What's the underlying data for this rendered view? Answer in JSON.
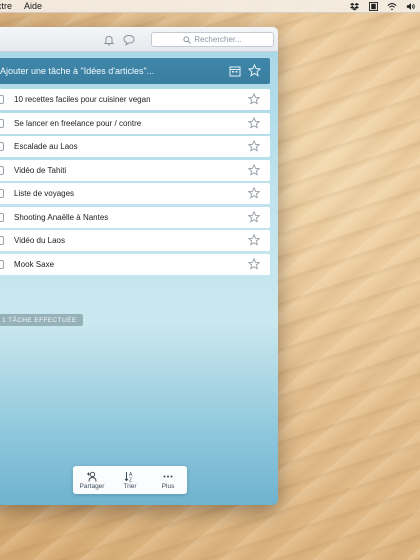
{
  "menubar": {
    "items": [
      "ctre",
      "Aide"
    ]
  },
  "window": {
    "search": {
      "placeholder": "Rechercher..."
    },
    "add_task": {
      "placeholder": "Ajouter une tâche à \"Idées d'articles\"..."
    },
    "tasks": [
      {
        "label": "10 recettes faciles pour cuisiner vegan",
        "checked": false,
        "starred": false
      },
      {
        "label": "Se lancer en freelance pour / contre",
        "checked": false,
        "starred": false
      },
      {
        "label": "Escalade au Laos",
        "checked": false,
        "starred": false
      },
      {
        "label": "Vidéo de Tahiti",
        "checked": false,
        "starred": false
      },
      {
        "label": "Liste de voyages",
        "checked": false,
        "starred": false
      },
      {
        "label": "Shooting Anaëlle à Nantes",
        "checked": false,
        "starred": false
      },
      {
        "label": "Vidéo du Laos",
        "checked": false,
        "starred": false
      },
      {
        "label": "Mook Saxe",
        "checked": false,
        "starred": false
      }
    ],
    "completed_badge": "1 TÂCHE EFFECTUÉE",
    "toolbar": {
      "share": "Partager",
      "sort": "Trier",
      "more": "Plus"
    }
  },
  "colors": {
    "add_bar": "#3f86a8",
    "accent_sky": "#a7d6e6",
    "sea": "#6fb3cf"
  }
}
